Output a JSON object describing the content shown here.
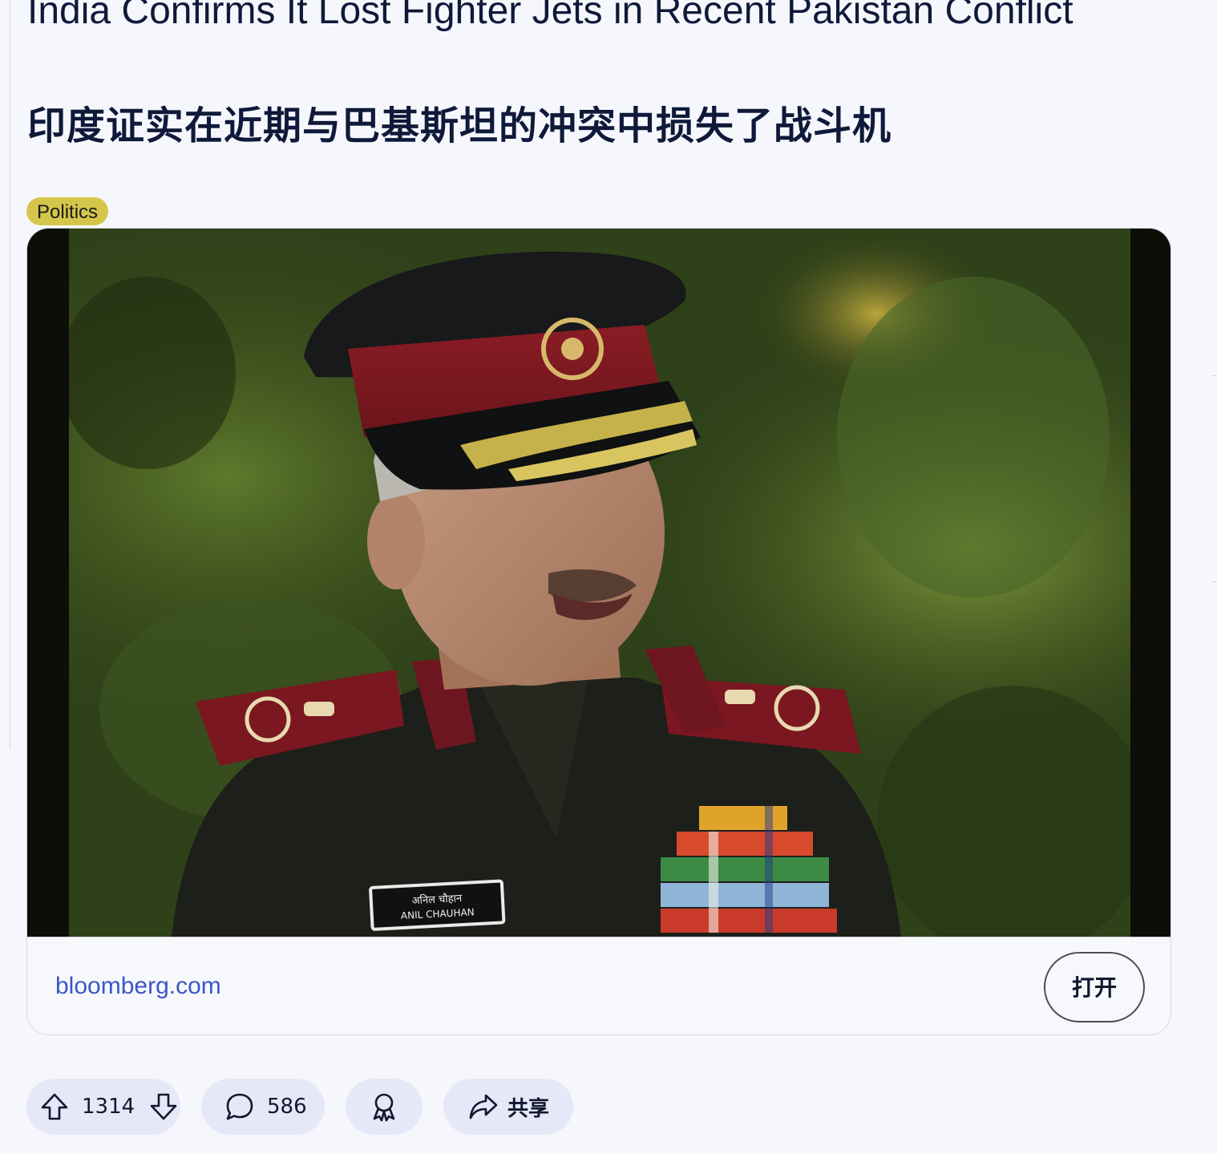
{
  "post": {
    "title_en": "India Confirms It Lost Fighter Jets in Recent Pakistan Conflict",
    "title_zh": "印度证实在近期与巴基斯坦的冲突中损失了战斗机",
    "flair": "Politics"
  },
  "link_card": {
    "source": "bloomberg.com",
    "open_label": "打开",
    "badge_text": [
      "अनिल चौहान",
      "ANIL CHAUHAN"
    ]
  },
  "actions": {
    "votes": "1314",
    "comments": "586",
    "share_label": "共享"
  },
  "colors": {
    "flair": "#d4c64a",
    "link": "#3b55c6",
    "pill": "#e6e8f8",
    "background": "#f6f7fc"
  },
  "icons": [
    "upvote-icon",
    "downvote-icon",
    "comment-icon",
    "award-icon",
    "share-icon"
  ]
}
